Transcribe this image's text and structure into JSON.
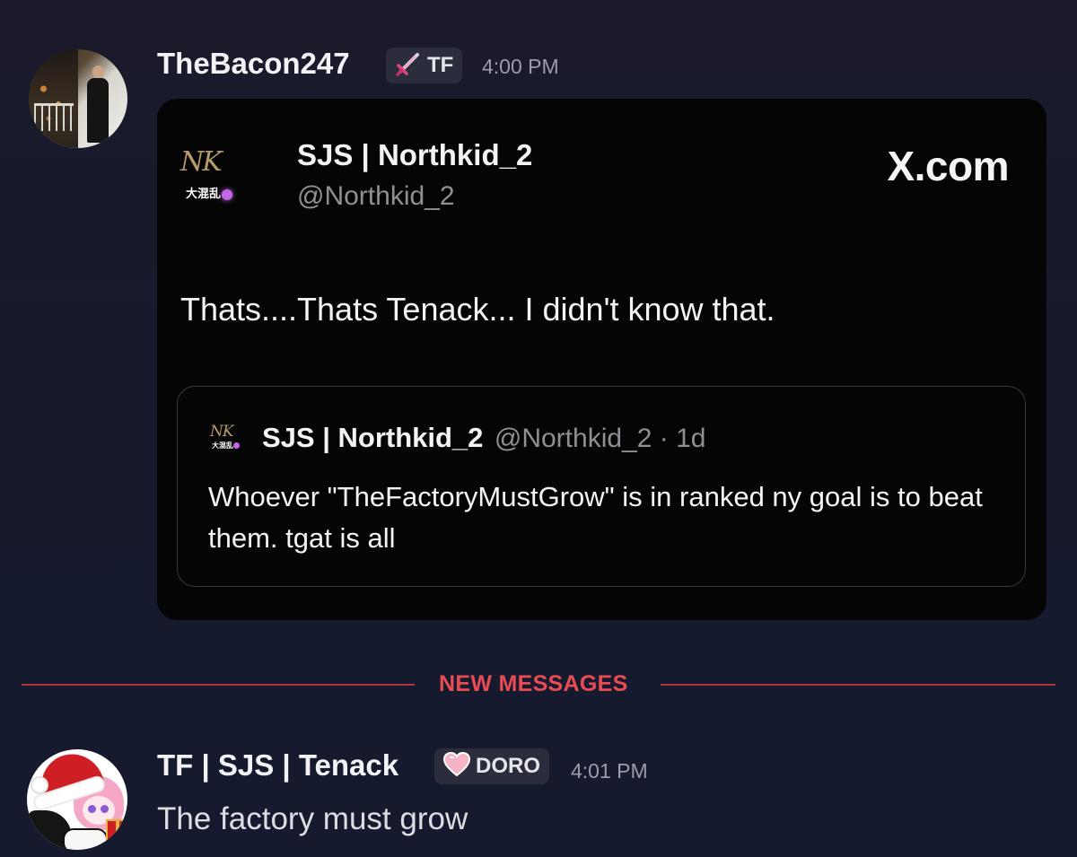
{
  "messages": [
    {
      "author": "TheBacon247",
      "role_tag": {
        "icon": "sword-icon",
        "text": "TF"
      },
      "timestamp": "4:00 PM",
      "embed": {
        "site": "X.com",
        "author_name": "SJS | Northkid_2",
        "author_handle": "@Northkid_2",
        "avatar_text": "大混乱",
        "text": "Thats....Thats Tenack... I didn't know that.",
        "quoted_post": {
          "author_name": "SJS | Northkid_2",
          "meta": "@Northkid_2 · 1d",
          "avatar_text": "大混乱",
          "text": "Whoever \"TheFactoryMustGrow\" is in ranked ny goal is to beat them. tgat is all"
        }
      }
    },
    {
      "author": "TF | SJS | Tenack",
      "role_tag": {
        "icon": "heart-icon",
        "text": "DORO"
      },
      "timestamp": "4:01 PM",
      "text": "The factory must grow"
    }
  ],
  "divider": {
    "label": "NEW MESSAGES",
    "color": "#e84b52"
  },
  "colors": {
    "background": "#171a2d",
    "embed_background": "#050505",
    "username": "#f2f3f5",
    "timestamp": "#9a9caa",
    "secondary_text": "#8e9096"
  }
}
